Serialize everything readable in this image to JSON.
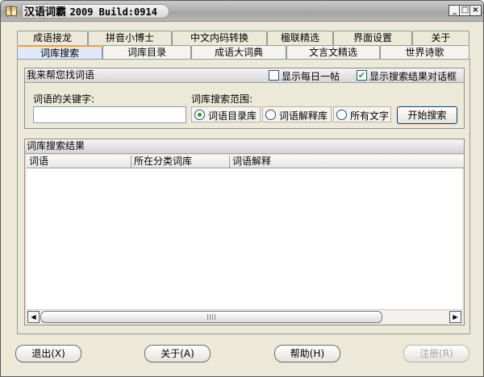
{
  "window": {
    "title": "汉语词霸",
    "build": "2009 Build:0914",
    "minimize_glyph": "_",
    "maximize_glyph": "□",
    "close_glyph": "×"
  },
  "tabs_row1": [
    "成语接龙",
    "拼音小博士",
    "中文内码转换",
    "楹联精选",
    "界面设置",
    "关于"
  ],
  "tabs_row2": [
    "词库搜索",
    "词库目录",
    "成语大词典",
    "文言文精选",
    "世界诗歌"
  ],
  "active_tab": "词库搜索",
  "search_group": {
    "header": "我来帮您找词语",
    "show_daily_label": "显示每日一帖",
    "show_daily_checked": false,
    "show_results_dialog_label": "显示搜索结果对话框",
    "show_results_dialog_checked": true,
    "keyword_label": "词语的关键字:",
    "keyword_value": "",
    "scope_label": "词库搜索范围:",
    "scope_options": [
      "词语目录库",
      "词语解释库",
      "所有文字"
    ],
    "scope_selected": "词语目录库",
    "search_button": "开始搜索"
  },
  "results": {
    "header": "词库搜索结果",
    "columns": [
      "词语",
      "所在分类词库",
      "词语解释"
    ],
    "rows": []
  },
  "scrollbar": {
    "left_glyph": "◀",
    "right_glyph": "▶"
  },
  "bottom_buttons": {
    "exit": "退出(X)",
    "about": "关于(A)",
    "help": "帮助(H)",
    "register": "注册(R)"
  },
  "colors": {
    "window_bg": "#ece9d8",
    "active_tab_accent": "#e6a23c",
    "check_green": "#21a121"
  }
}
